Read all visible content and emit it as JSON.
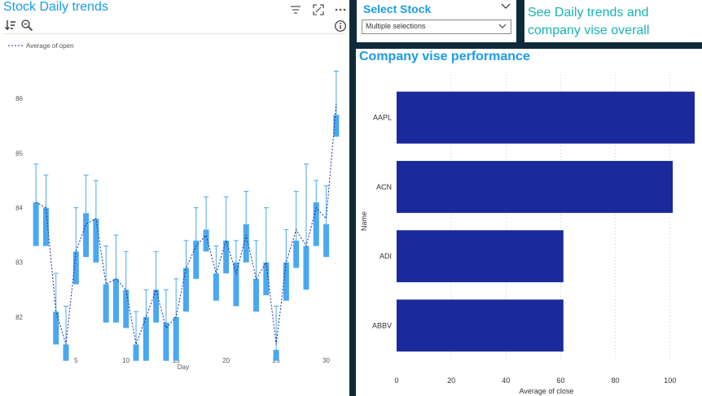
{
  "colors": {
    "background": "#0f2b3a",
    "title": "#1a9be6",
    "note": "#19b3b0",
    "candle": "#4aa8f0",
    "bar": "#1a2a9c"
  },
  "left_visual": {
    "title": "Stock Daily trends",
    "icons": [
      "sort-icon",
      "zoom-icon",
      "filter-icon",
      "focus-mode-icon",
      "more-options-icon",
      "info-icon"
    ]
  },
  "slicer": {
    "title": "Select Stock",
    "value": "Multiple selections"
  },
  "note": {
    "text": "See Daily trends and company vise overall"
  },
  "right_visual": {
    "title": "Company vise performance"
  },
  "chart_data": [
    {
      "type": "candlestick",
      "legend": "Average of open",
      "xlabel": "Day",
      "ylabel": "",
      "x_ticks": [
        5,
        10,
        15,
        20,
        25,
        30
      ],
      "y_ticks": [
        82,
        83,
        84,
        85,
        86
      ],
      "xlim": [
        0.5,
        31.5
      ],
      "ylim": [
        81.3,
        86.7
      ],
      "days": [
        1,
        2,
        3,
        4,
        5,
        6,
        7,
        8,
        9,
        10,
        11,
        12,
        13,
        14,
        15,
        16,
        17,
        18,
        19,
        20,
        21,
        22,
        23,
        24,
        25,
        26,
        27,
        28,
        29,
        30,
        31
      ],
      "open": [
        84.1,
        84.0,
        82.1,
        81.5,
        83.2,
        83.9,
        83.8,
        82.6,
        82.7,
        82.5,
        81.5,
        82.0,
        82.5,
        81.9,
        82.0,
        82.9,
        83.4,
        83.6,
        82.8,
        83.4,
        83.0,
        83.7,
        82.7,
        83.0,
        81.4,
        83.0,
        83.4,
        83.3,
        84.1,
        83.7,
        85.7
      ],
      "close": [
        83.3,
        83.3,
        81.5,
        81.2,
        82.6,
        83.1,
        83.0,
        81.9,
        81.9,
        81.8,
        81.2,
        81.2,
        81.9,
        81.2,
        81.2,
        82.1,
        82.7,
        83.2,
        82.3,
        82.8,
        82.2,
        83.0,
        82.1,
        82.4,
        81.2,
        82.3,
        82.9,
        82.5,
        83.3,
        83.1,
        85.3
      ],
      "high": [
        84.8,
        84.6,
        82.8,
        82.2,
        84.0,
        84.6,
        84.5,
        83.3,
        83.5,
        83.2,
        82.1,
        82.5,
        83.2,
        82.5,
        82.7,
        83.4,
        84.0,
        84.2,
        83.3,
        84.2,
        83.4,
        84.3,
        83.4,
        84.0,
        82.2,
        83.6,
        84.3,
        84.8,
        84.5,
        84.4,
        86.5
      ],
      "low": [
        83.3,
        83.3,
        81.5,
        81.2,
        82.6,
        83.1,
        83.0,
        81.9,
        81.9,
        81.8,
        81.2,
        81.2,
        81.9,
        81.2,
        81.2,
        82.1,
        82.7,
        83.2,
        82.3,
        82.8,
        82.2,
        83.0,
        82.1,
        82.4,
        81.2,
        82.3,
        82.9,
        82.5,
        83.3,
        83.1,
        85.3
      ],
      "avg_open": [
        84.1,
        84.0,
        82.1,
        81.5,
        83.2,
        83.7,
        83.8,
        82.6,
        82.7,
        82.5,
        81.5,
        82.0,
        82.5,
        81.8,
        82.0,
        82.9,
        83.3,
        83.5,
        82.8,
        83.4,
        82.8,
        83.5,
        82.7,
        83.0,
        81.5,
        83.0,
        83.6,
        83.3,
        84.0,
        83.8,
        85.9
      ]
    },
    {
      "type": "bar",
      "orientation": "horizontal",
      "categories": [
        "AAPL",
        "ACN",
        "ADI",
        "ABBV"
      ],
      "values": [
        109,
        101,
        61,
        61
      ],
      "xlabel": "Average of close",
      "ylabel": "Name",
      "x_ticks": [
        0,
        20,
        40,
        60,
        80,
        100
      ],
      "xlim": [
        0,
        109
      ]
    }
  ]
}
